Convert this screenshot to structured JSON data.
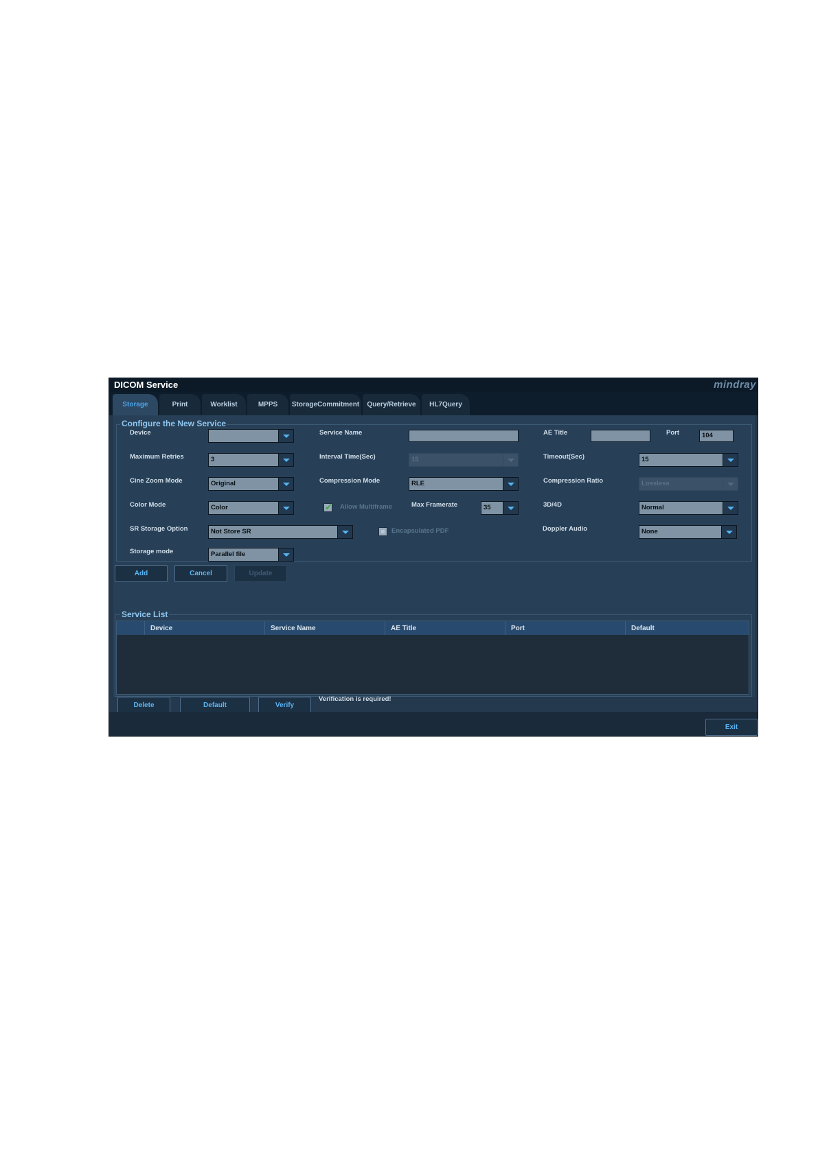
{
  "window": {
    "title": "DICOM Service",
    "brand": "mindray"
  },
  "tabs": [
    {
      "label": "Storage",
      "active": true
    },
    {
      "label": "Print"
    },
    {
      "label": "Worklist"
    },
    {
      "label": "MPPS"
    },
    {
      "label": "StorageCommitment"
    },
    {
      "label": "Query/Retrieve"
    },
    {
      "label": "HL7Query"
    }
  ],
  "configure": {
    "title": "Configure the New Service",
    "device": {
      "label": "Device",
      "value": ""
    },
    "service_name": {
      "label": "Service Name",
      "value": ""
    },
    "ae_title": {
      "label": "AE Title",
      "value": ""
    },
    "port": {
      "label": "Port",
      "value": "104"
    },
    "max_retries": {
      "label": "Maximum Retries",
      "value": "3"
    },
    "interval_time": {
      "label": "Interval Time(Sec)",
      "value": "15"
    },
    "timeout": {
      "label": "Timeout(Sec)",
      "value": "15"
    },
    "cine_zoom_mode": {
      "label": "Cine Zoom Mode",
      "value": "Original"
    },
    "compression_mode": {
      "label": "Compression Mode",
      "value": "RLE"
    },
    "compression_ratio": {
      "label": "Compression Ratio",
      "value": "Lossless"
    },
    "color_mode": {
      "label": "Color Mode",
      "value": "Color"
    },
    "allow_multiframe": {
      "label": "Allow Multiframe",
      "checked": true
    },
    "max_framerate": {
      "label": "Max Framerate",
      "value": "35"
    },
    "three_d_four_d": {
      "label": "3D/4D",
      "value": "Normal"
    },
    "sr_storage_option": {
      "label": "SR Storage Option",
      "value": "Not Store SR"
    },
    "encapsulated_pdf": {
      "label": "Encapsulated PDF",
      "checked": false
    },
    "doppler_audio": {
      "label": "Doppler Audio",
      "value": "None"
    },
    "storage_mode": {
      "label": "Storage mode",
      "value": "Parallel file"
    }
  },
  "actions": {
    "add": "Add",
    "cancel": "Cancel",
    "update": "Update"
  },
  "service_list": {
    "title": "Service List",
    "columns": [
      "Device",
      "Service Name",
      "AE Title",
      "Port",
      "Default"
    ],
    "rows": []
  },
  "list_actions": {
    "delete": "Delete",
    "default": "Default",
    "verify": "Verify",
    "status": "Verification is required!"
  },
  "footer": {
    "exit": "Exit"
  },
  "colors": {
    "background": "#23384c",
    "accent": "#56b2f2",
    "active_tab": "#4fa2e6"
  }
}
